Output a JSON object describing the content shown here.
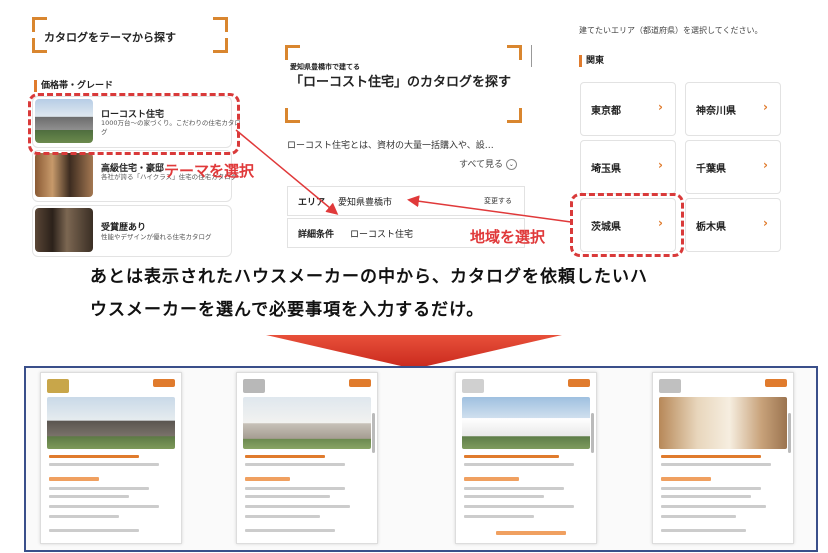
{
  "left_panel": {
    "heading": "カタログをテーマから探す",
    "section_label": "価格帯・グレード",
    "cards": [
      {
        "title": "ローコスト住宅",
        "desc": "1000万台〜の家づくり。こだわりの住宅カタログ"
      },
      {
        "title": "高級住宅・豪邸",
        "desc": "各社が誇る「ハイクラス」住宅の住宅カタログ"
      },
      {
        "title": "受賞歴あり",
        "desc": "性能やデザインが優れる住宅カタログ"
      }
    ]
  },
  "middle_panel": {
    "subtitle": "愛知県豊橋市で建てる",
    "title": "「ローコスト住宅」のカタログを探す",
    "description": "ローコスト住宅とは、資材の大量一括購入や、設…",
    "see_all": "すべて見る",
    "area_label": "エリア",
    "area_value": "愛知県豊橋市",
    "change_button": "変更する",
    "detail_label": "詳細条件",
    "detail_value": "ローコスト住宅"
  },
  "right_panel": {
    "instruction": "建てたいエリア（都道府県）を選択してください。",
    "region": "関東",
    "prefectures": [
      "東京都",
      "神奈川県",
      "埼玉県",
      "千葉県",
      "茨城県",
      "栃木県"
    ]
  },
  "annotations": {
    "theme_select": "テーマを選択",
    "region_select": "地域を選択"
  },
  "main_text": {
    "line1": "あとは表示されたハウスメーカーの中から、カタログを依頼したいハ",
    "line2": "ウスメーカーを選んで必要事項を入力するだけ。"
  },
  "colors": {
    "accent": "#e07b2d",
    "annotation_red": "#d93a3a",
    "frame_blue": "#3a4f8a",
    "arrow_red": "#e03a2a"
  }
}
